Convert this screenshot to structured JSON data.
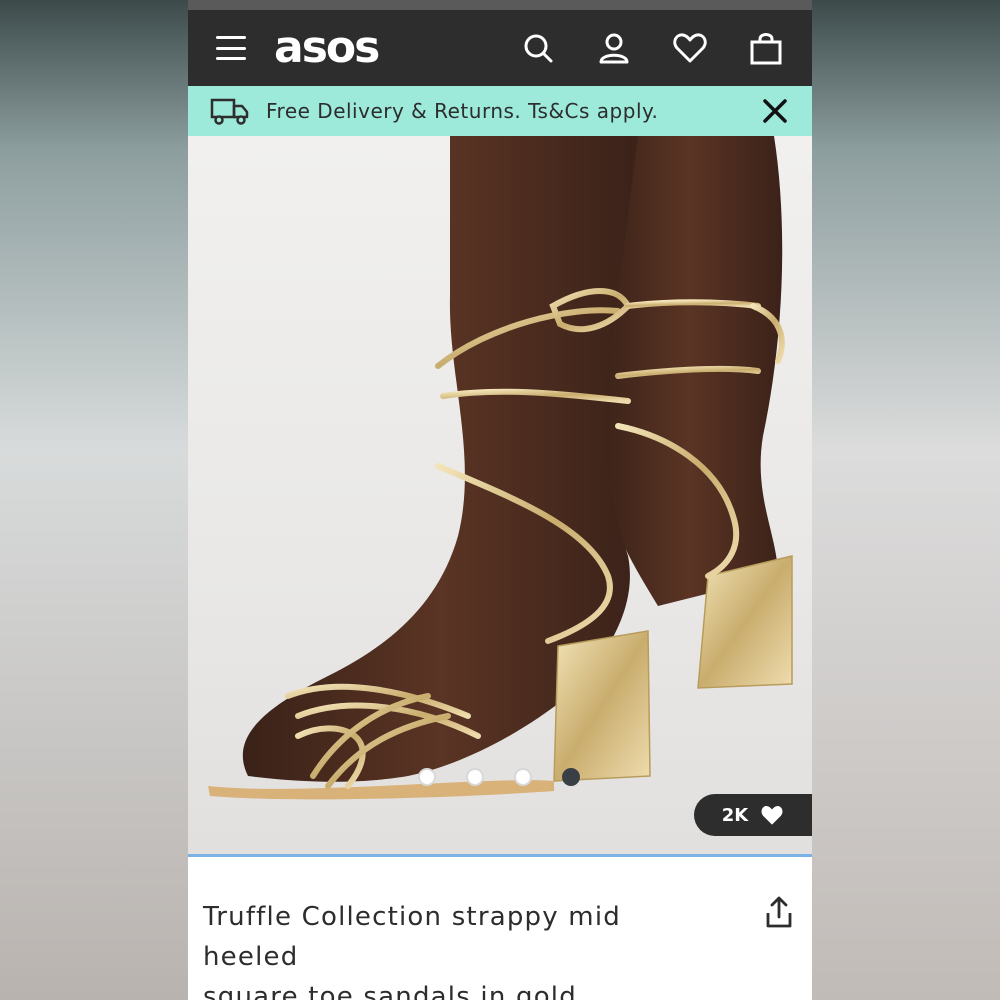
{
  "brand": {
    "logo_text": "asos"
  },
  "header": {
    "icons": [
      "menu-icon",
      "search-icon",
      "account-icon",
      "heart-icon",
      "bag-icon"
    ]
  },
  "banner": {
    "text": "Free Delivery & Returns. Ts&Cs apply.",
    "background": "#9deadb"
  },
  "gallery": {
    "image_count": 4,
    "active_index": 3,
    "likes_count": "2K"
  },
  "product": {
    "title_line1": "Truffle Collection strappy mid heeled",
    "title_line2": "square toe sandals in gold"
  },
  "colors": {
    "header_bg": "#2d2d2d",
    "accent_blue": "#7cb2e6"
  }
}
